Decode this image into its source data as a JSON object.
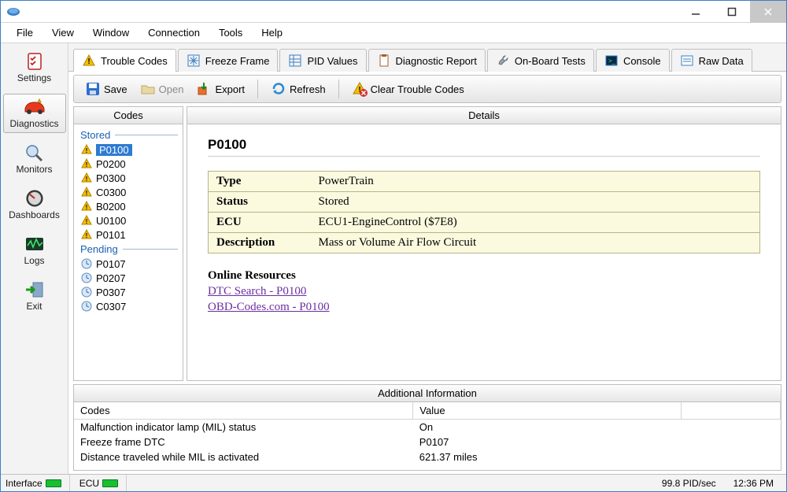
{
  "window": {
    "title": ""
  },
  "menu": {
    "items": [
      "File",
      "View",
      "Window",
      "Connection",
      "Tools",
      "Help"
    ]
  },
  "sidebar": {
    "items": [
      {
        "label": "Settings"
      },
      {
        "label": "Diagnostics"
      },
      {
        "label": "Monitors"
      },
      {
        "label": "Dashboards"
      },
      {
        "label": "Logs"
      },
      {
        "label": "Exit"
      }
    ]
  },
  "tabs": {
    "active": 0,
    "items": [
      {
        "label": "Trouble Codes"
      },
      {
        "label": "Freeze Frame"
      },
      {
        "label": "PID Values"
      },
      {
        "label": "Diagnostic Report"
      },
      {
        "label": "On-Board Tests"
      },
      {
        "label": "Console"
      },
      {
        "label": "Raw Data"
      }
    ]
  },
  "toolbar": {
    "save": "Save",
    "open": "Open",
    "export": "Export",
    "refresh": "Refresh",
    "clear": "Clear Trouble Codes"
  },
  "codes_panel": {
    "header": "Codes",
    "stored_label": "Stored",
    "pending_label": "Pending",
    "stored": [
      "P0100",
      "P0200",
      "P0300",
      "C0300",
      "B0200",
      "U0100",
      "P0101"
    ],
    "pending": [
      "P0107",
      "P0207",
      "P0307",
      "C0307"
    ],
    "selected": "P0100"
  },
  "details_panel": {
    "header": "Details",
    "code": "P0100",
    "rows": {
      "type_label": "Type",
      "type_value": "PowerTrain",
      "status_label": "Status",
      "status_value": "Stored",
      "ecu_label": "ECU",
      "ecu_value": "ECU1-EngineControl ($7E8)",
      "desc_label": "Description",
      "desc_value": "Mass or Volume Air Flow Circuit"
    },
    "online_heading": "Online Resources",
    "link1": "DTC Search - P0100",
    "link2": "OBD-Codes.com - P0100"
  },
  "addinfo": {
    "header": "Additional Information",
    "col_codes": "Codes",
    "col_value": "Value",
    "rows": [
      {
        "k": "Malfunction indicator lamp (MIL) status",
        "v": "On"
      },
      {
        "k": "Freeze frame DTC",
        "v": "P0107"
      },
      {
        "k": "Distance traveled while MIL is activated",
        "v": "621.37 miles"
      }
    ]
  },
  "status": {
    "interface_label": "Interface",
    "ecu_label": "ECU",
    "pid_rate": "99.8 PID/sec",
    "clock": "12:36 PM"
  }
}
